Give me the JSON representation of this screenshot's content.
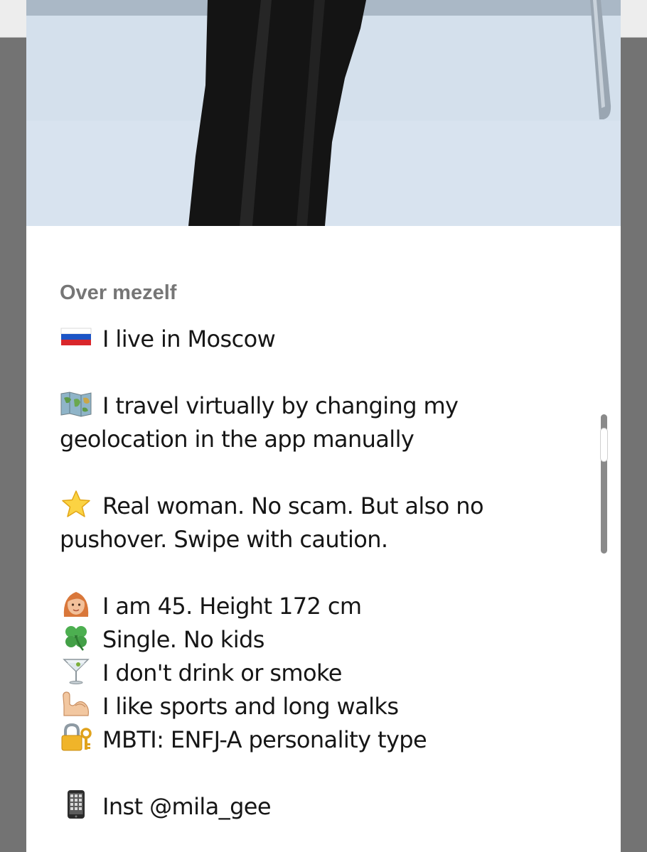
{
  "profile": {
    "section_title": "Over mezelf",
    "bio_lines": [
      {
        "icon": "russia-flag-icon",
        "text": "I live in Moscow"
      },
      {
        "icon": "world-map-icon",
        "text": "I travel virtually by changing my"
      },
      {
        "icon": "",
        "text": "geolocation in the app manually"
      },
      {
        "icon": "star-icon",
        "text": "Real woman. No scam. But also no"
      },
      {
        "icon": "",
        "text": "pushover. Swipe with caution."
      },
      {
        "icon": "woman-icon",
        "text": "I am 45. Height 172 cm"
      },
      {
        "icon": "four-leaf-clover-icon",
        "text": "Single. No kids"
      },
      {
        "icon": "cocktail-glass-icon",
        "text": "I don't drink or smoke"
      },
      {
        "icon": "flexed-biceps-icon",
        "text": "I like sports and long walks"
      },
      {
        "icon": "lock-with-key-icon",
        "text": "MBTI: ENFJ-A personality type"
      },
      {
        "icon": "mobile-phone-icon",
        "text": "Inst @mila_gee"
      }
    ]
  },
  "colors": {
    "card_background": "#ffffff",
    "overlay": "#737373",
    "section_title": "#767676",
    "body_text": "#161616",
    "photo_backdrop": "#d3dfeb"
  }
}
